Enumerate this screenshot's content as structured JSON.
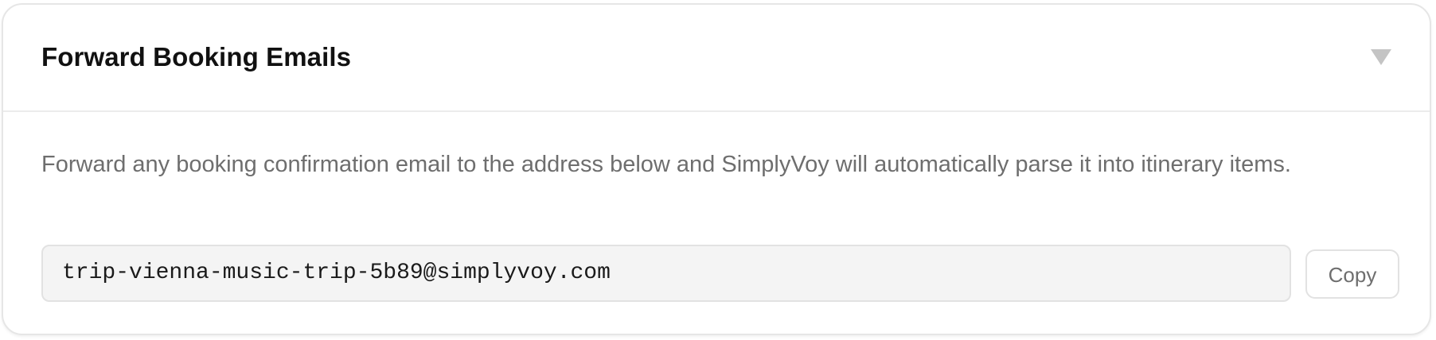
{
  "section": {
    "title": "Forward Booking Emails",
    "toggle_icon": "triangle-down-icon",
    "description": "Forward any booking confirmation email to the address below and SimplyVoy will automatically parse it into itinerary items.",
    "forward_email": "trip-vienna-music-trip-5b89@simplyvoy.com",
    "copy_label": "Copy"
  },
  "colors": {
    "title": "#111111",
    "muted_text": "#6e6e6e",
    "field_background": "#f4f4f4",
    "border": "#e2e2e2",
    "toggle_icon": "#c4c4c4"
  }
}
